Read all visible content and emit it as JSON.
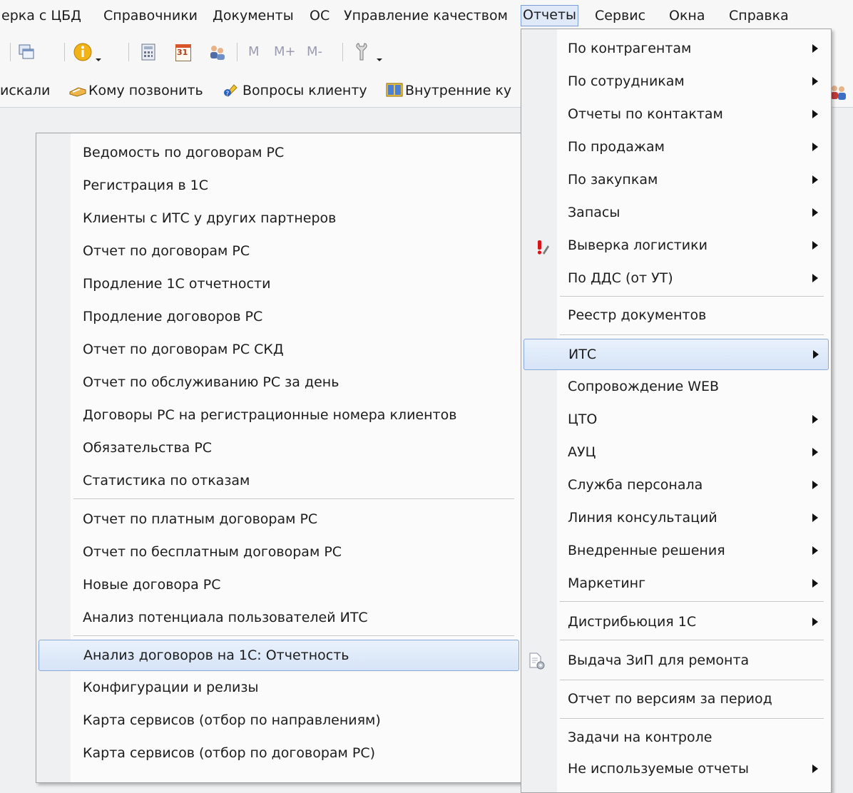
{
  "menubar": [
    {
      "id": "sverka",
      "label": "ерка с ЦБД"
    },
    {
      "id": "spravochniki",
      "label": "Справочники"
    },
    {
      "id": "dokumenty",
      "label": "Документы"
    },
    {
      "id": "os",
      "label": "ОС"
    },
    {
      "id": "kachestvo",
      "label": "Управление качеством"
    },
    {
      "id": "otchety",
      "label": "Отчеты"
    },
    {
      "id": "servis",
      "label": "Сервис"
    },
    {
      "id": "okna",
      "label": "Окна"
    },
    {
      "id": "spravka",
      "label": "Справка"
    }
  ],
  "toolbar": {
    "m_label": "M",
    "mplus_label": "M+",
    "mminus_label": "M-",
    "calendar_digits": "31"
  },
  "linkbar": [
    {
      "label": "искали"
    },
    {
      "label": "Кому позвонить"
    },
    {
      "label": "Вопросы клиенту"
    },
    {
      "label": "Внутренние ку"
    }
  ],
  "reports_menu": [
    {
      "label": "По контрагентам",
      "submenu": true
    },
    {
      "label": "По сотрудникам",
      "submenu": true
    },
    {
      "label": "Отчеты по контактам",
      "submenu": true
    },
    {
      "label": "По продажам",
      "submenu": true
    },
    {
      "label": "По закупкам",
      "submenu": true
    },
    {
      "label": "Запасы",
      "submenu": true
    },
    {
      "label": "Выверка логистики",
      "submenu": true,
      "icon": "warning-pencil-icon"
    },
    {
      "label": "По ДДС  (от УТ)",
      "submenu": true
    },
    {
      "label": "Реестр документов",
      "submenu": false
    },
    {
      "label": "ИТС",
      "submenu": true,
      "highlighted": true
    },
    {
      "label": "Сопровождение WEB",
      "submenu": false
    },
    {
      "label": "ЦТО",
      "submenu": true
    },
    {
      "label": "АУЦ",
      "submenu": true
    },
    {
      "label": "Служба персонала",
      "submenu": true
    },
    {
      "label": "Линия консультаций",
      "submenu": true
    },
    {
      "label": "Внедренные решения",
      "submenu": true
    },
    {
      "label": "Маркетинг",
      "submenu": true
    },
    {
      "label": "Дистрибьюция 1С",
      "submenu": true
    },
    {
      "label": "Выдача ЗиП для ремонта",
      "submenu": false,
      "icon": "document-gear-icon"
    },
    {
      "label": "Отчет по версиям за период",
      "submenu": false
    },
    {
      "label": "Задачи на контроле",
      "submenu": false
    },
    {
      "label": "Не используемые отчеты",
      "submenu": true
    }
  ],
  "its_submenu": [
    {
      "label": "Ведомость по договорам РС"
    },
    {
      "label": "Регистрация в 1С"
    },
    {
      "label": "Клиенты с ИТС у других партнеров"
    },
    {
      "label": "Отчет по договорам РС"
    },
    {
      "label": "Продление 1С отчетности"
    },
    {
      "label": "Продление договоров РС"
    },
    {
      "label": "Отчет по договорам РС СКД"
    },
    {
      "label": "Отчет по обслуживанию РС за день"
    },
    {
      "label": "Договоры РС на регистрационные номера клиентов"
    },
    {
      "label": "Обязательства РС"
    },
    {
      "label": "Статистика по отказам"
    },
    {
      "label": "Отчет по платным договорам РС"
    },
    {
      "label": "Отчет по бесплатным договорам РС"
    },
    {
      "label": "Новые договора РС"
    },
    {
      "label": "Анализ потенциала пользователей ИТС"
    },
    {
      "label": "Анализ договоров на 1С: Отчетность",
      "highlighted": true
    },
    {
      "label": "Конфигурации и релизы"
    },
    {
      "label": "Карта сервисов (отбор по направлениям)"
    },
    {
      "label": "Карта сервисов (отбор по договорам РС)"
    }
  ],
  "colors": {
    "highlight_fill": "#dde8f8",
    "highlight_border": "#8aa8d8",
    "menu_bg": "#fbfbfb",
    "gutter_bg": "#eef0f1"
  }
}
